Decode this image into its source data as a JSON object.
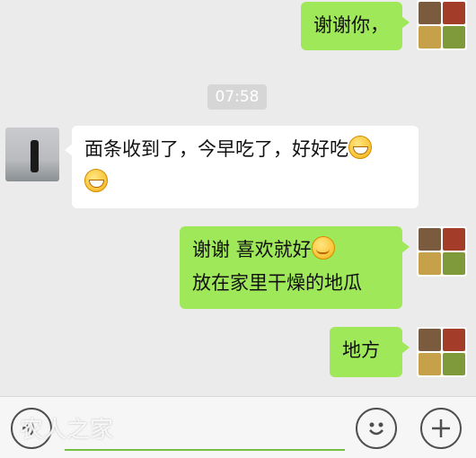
{
  "messages": [
    {
      "sender": "me",
      "text": "谢谢你，"
    },
    {
      "sender": "other",
      "line1": "面条收到了，今早吃了，好好吃",
      "emoji": "grin"
    },
    {
      "sender": "me",
      "line1": "谢谢 喜欢就好",
      "line2": "放在家里干燥的地瓜",
      "emoji": "smile"
    },
    {
      "sender": "me",
      "text": "地方"
    }
  ],
  "timestamp": "07:58",
  "input": {
    "placeholder": "",
    "watermark": "农人之家"
  },
  "icons": {
    "voice": "voice-icon",
    "emoji": "emoji-face-icon",
    "add": "plus-icon"
  },
  "colors": {
    "my_bubble": "#9fe85a",
    "other_bubble": "#ffffff",
    "background": "#ebebeb",
    "input_underline": "#72c143"
  }
}
